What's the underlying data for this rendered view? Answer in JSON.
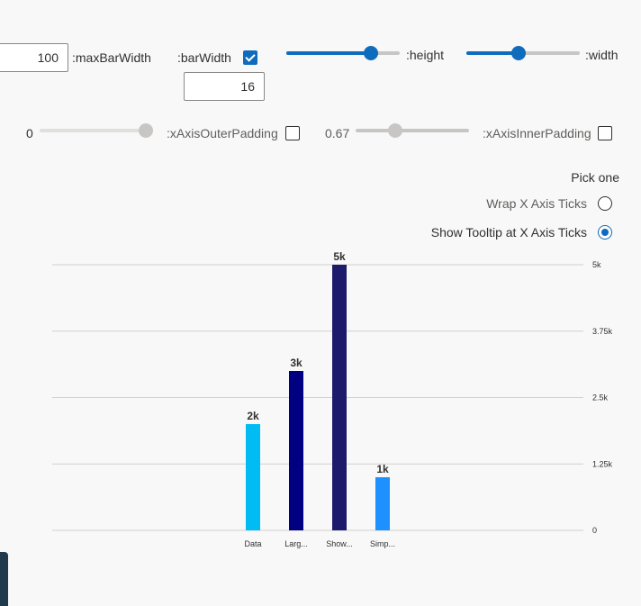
{
  "controls": {
    "max_bar_width": {
      "value": "100",
      "label": ":maxBarWidth"
    },
    "bar_width": {
      "label": ":barWidth",
      "checked": true,
      "value": "16"
    },
    "height": {
      "label": ":height",
      "level": 0.78
    },
    "width": {
      "label": ":width",
      "level": 0.45
    },
    "x_axis_outer_padding": {
      "value": "0",
      "label": ":xAxisOuterPadding",
      "level": 1.0,
      "checked": false
    },
    "x_axis_inner_padding": {
      "value": "0.67",
      "label": ":xAxisInnerPadding",
      "level": 0.33,
      "checked": false
    }
  },
  "tick_mode": {
    "title": "Pick one",
    "options": [
      {
        "label": "Wrap X Axis Ticks",
        "selected": false
      },
      {
        "label": "Show Tooltip at X Axis Ticks",
        "selected": true
      }
    ]
  },
  "chart_data": {
    "type": "bar",
    "categories": [
      "Data",
      "Larg...",
      "Show...",
      "Simp..."
    ],
    "values": [
      2000,
      3000,
      5000,
      1000
    ],
    "data_labels": [
      "2k",
      "3k",
      "5k",
      "1k"
    ],
    "colors": [
      "#00bcf2",
      "#000080",
      "#1b1a6b",
      "#1e90ff"
    ],
    "ylim": [
      0,
      5000
    ],
    "yticks": [
      0,
      1250,
      2500,
      3750,
      5000
    ],
    "ytick_labels": [
      "0",
      "1.25k",
      "2.5k",
      "3.75k",
      "5k"
    ],
    "y_axis_side": "right",
    "grid": true
  }
}
